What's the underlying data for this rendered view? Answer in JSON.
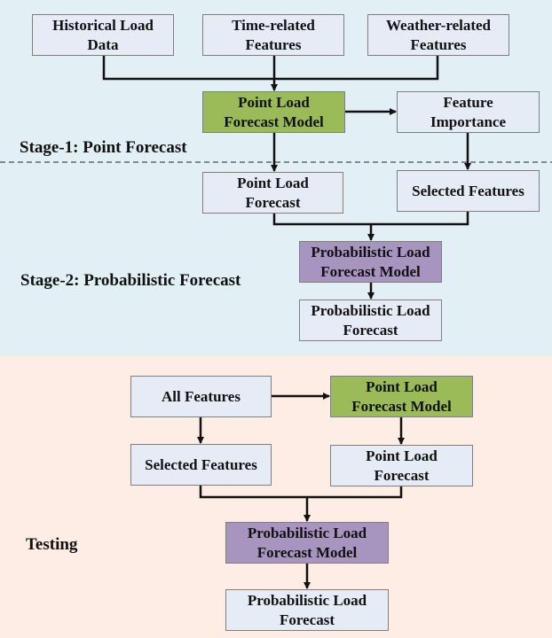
{
  "colors": {
    "stage_background": "#e2f0f5",
    "testing_background": "#fdede4",
    "box_fill": "#e6ecf6",
    "model_point_fill": "#9bbb59",
    "model_probabilistic_fill": "#a795c0"
  },
  "stage1": {
    "label": "Stage-1: Point Forecast",
    "inputs": [
      {
        "text": "Historical Load\nData"
      },
      {
        "text": "Time-related\nFeatures"
      },
      {
        "text": "Weather-related\nFeatures"
      }
    ],
    "point_model": "Point Load\nForecast Model",
    "feature_importance": "Feature\nImportance"
  },
  "stage2": {
    "label": "Stage-2: Probabilistic Forecast",
    "point_forecast": "Point Load\nForecast",
    "selected_features": "Selected Features",
    "prob_model": "Probabilistic Load\nForecast Model",
    "prob_forecast": "Probabilistic Load\nForecast"
  },
  "testing": {
    "label": "Testing",
    "all_features": "All Features",
    "point_model": "Point Load\nForecast Model",
    "selected_features": "Selected Features",
    "point_forecast": "Point Load\nForecast",
    "prob_model": "Probabilistic Load\nForecast Model",
    "prob_forecast": "Probabilistic Load\nForecast"
  }
}
